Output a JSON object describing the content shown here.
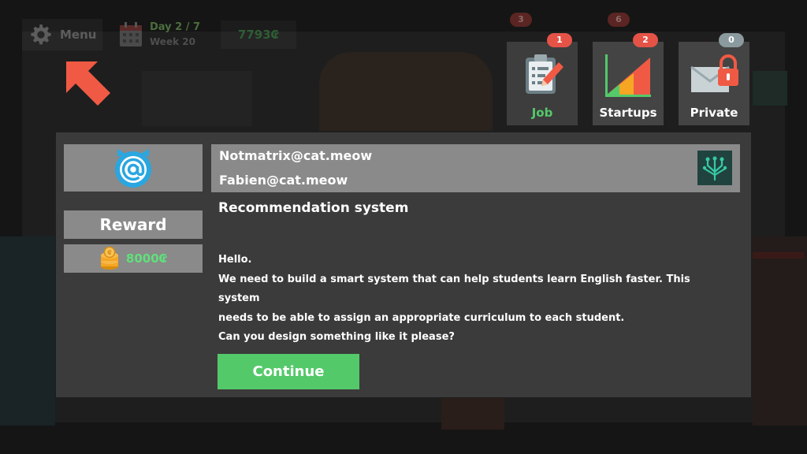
{
  "hud": {
    "menu_label": "Menu",
    "day_label": "Day 2 / 7",
    "week_label": "Week 20",
    "money": "7793₢"
  },
  "background_tabs": {
    "inbox_badge": "3",
    "shop_badge": "6"
  },
  "tabs": [
    {
      "label": "Job",
      "badge": "1",
      "icon": "clipboard-pencil-icon",
      "active": true
    },
    {
      "label": "Startups",
      "badge": "2",
      "icon": "growth-chart-icon",
      "active": false
    },
    {
      "label": "Private",
      "badge": "0",
      "icon": "locked-envelope-icon",
      "active": false
    }
  ],
  "email": {
    "from": "Notmatrix@cat.meow",
    "to": "Fabien@cat.meow",
    "subject": "Recommendation system",
    "body": [
      "Hello.",
      "We need to build a smart system that can help students learn English faster. This system",
      "needs to be able to assign an appropriate curriculum to each student.",
      "Can you design something like it please?"
    ],
    "sender_icon": "cat-at-icon",
    "company_icon": "circuit-tree-icon"
  },
  "reward": {
    "title": "Reward",
    "amount": "8000₢",
    "icon": "coin-stack-icon"
  },
  "actions": {
    "continue_label": "Continue"
  },
  "colors": {
    "accent_green": "#54c96a",
    "money_green": "#5fe07b",
    "badge_red": "#e55347",
    "badge_gray": "#8b9a9e",
    "arrow_orange": "#f05a45",
    "panel_gray": "#8a8a8a",
    "dialog_bg": "#3b3b3b"
  }
}
